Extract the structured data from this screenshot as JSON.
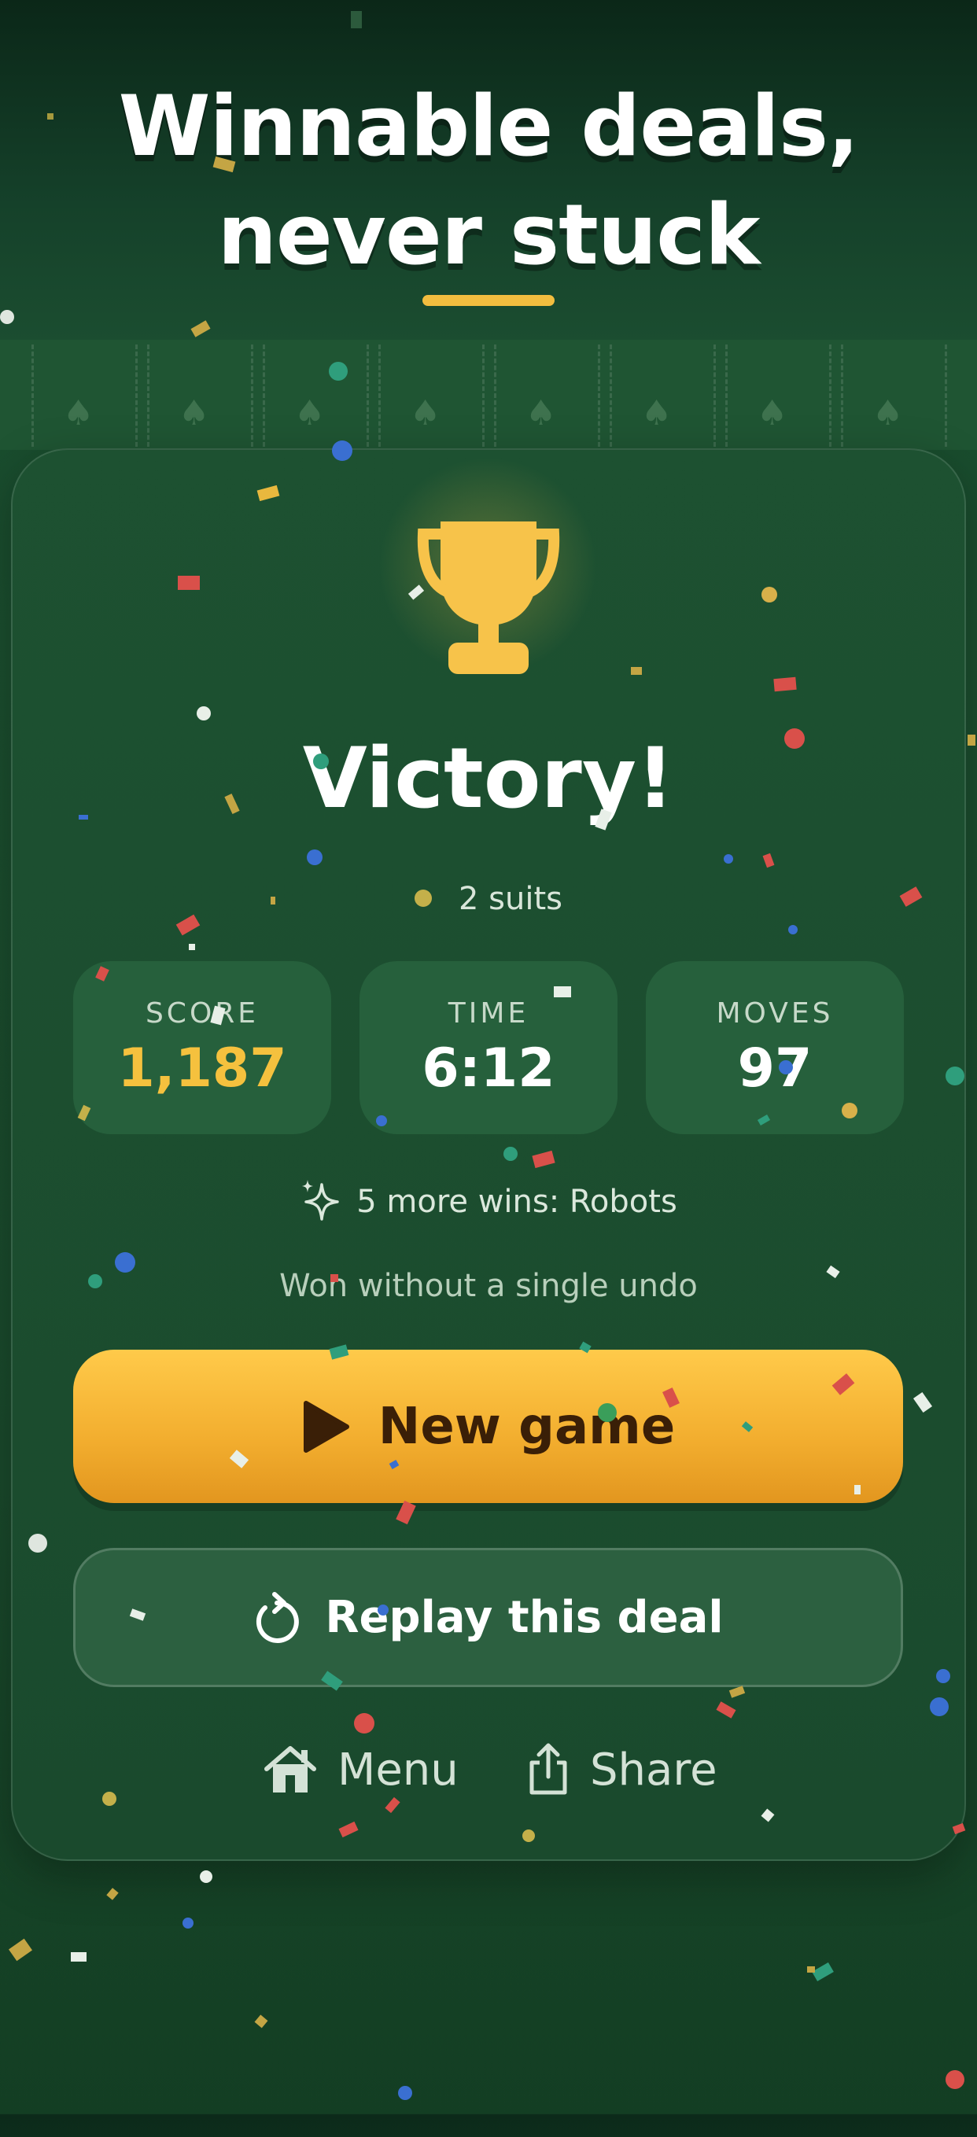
{
  "headline": {
    "line1": "Winnable deals,",
    "line2": "never stuck"
  },
  "result": {
    "title": "Victory!",
    "mode": "2 suits"
  },
  "stats": [
    {
      "label": "SCORE",
      "value": "1,187"
    },
    {
      "label": "TIME",
      "value": "6:12"
    },
    {
      "label": "MOVES",
      "value": "97"
    }
  ],
  "unlock_text": "5 more wins: Robots",
  "undo_note": "Won without a single undo",
  "buttons": {
    "new_game": "New game",
    "replay": "Replay this deal"
  },
  "footer": {
    "menu": "Menu",
    "share": "Share"
  },
  "colors": {
    "accent": "#f5c13e",
    "felt": "#1b4f2f",
    "button_text": "#3a1f07"
  },
  "icons": [
    "trophy-icon",
    "sparkle-icon",
    "play-icon",
    "replay-icon",
    "home-icon",
    "share-icon",
    "spade-icon"
  ]
}
